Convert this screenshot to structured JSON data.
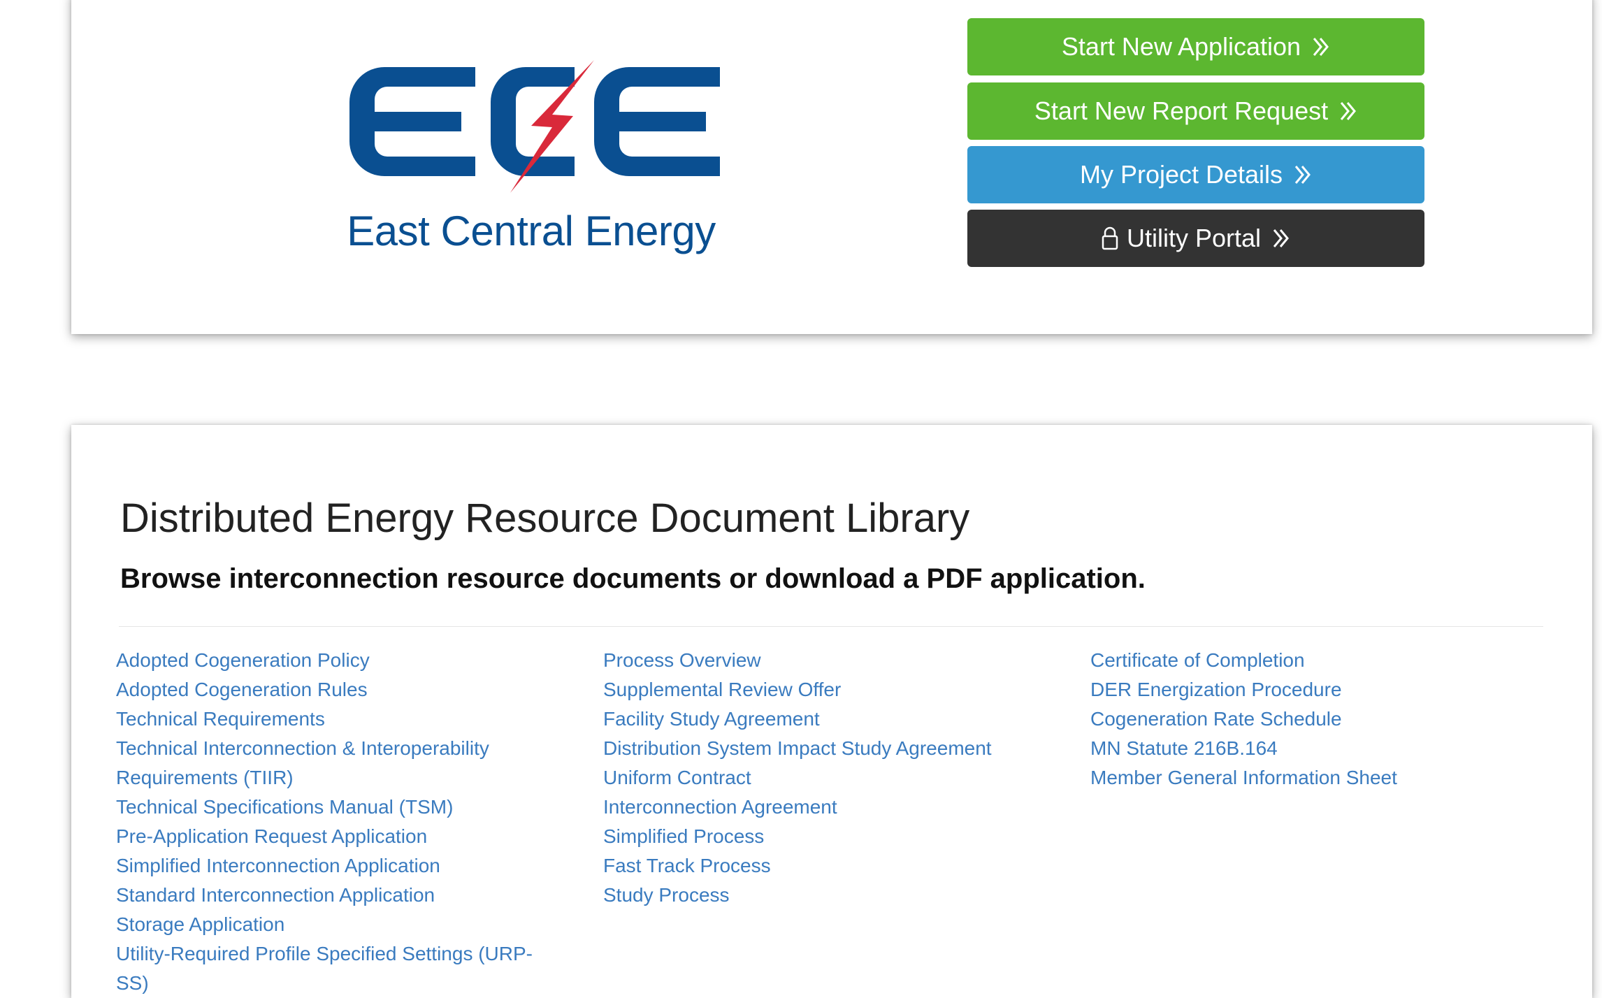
{
  "header": {
    "logo": {
      "lettering": "ECE",
      "name": "East Central Energy",
      "colors": {
        "blue": "#0a4f91",
        "red": "#d9293a"
      }
    },
    "buttons": [
      {
        "label": "Start New Application",
        "icon": "double-chevron-right-icon",
        "color": "#5cb730"
      },
      {
        "label": "Start New Report Request",
        "icon": "double-chevron-right-icon",
        "color": "#5cb730"
      },
      {
        "label": "My Project Details",
        "icon": "double-chevron-right-icon",
        "color": "#3598d0"
      },
      {
        "label": "Utility Portal",
        "icon": "double-chevron-right-icon",
        "leading_icon": "lock-icon",
        "color": "#333333"
      }
    ]
  },
  "library": {
    "title": "Distributed Energy Resource Document Library",
    "subtitle": "Browse interconnection resource documents or download a PDF application.",
    "link_color": "#3a7bbf",
    "columns": [
      [
        "Adopted Cogeneration Policy",
        "Adopted Cogeneration Rules",
        "Technical Requirements",
        "Technical Interconnection & Interoperability Requirements (TIIR)",
        "Technical Specifications Manual (TSM)",
        "Pre-Application Request Application",
        "Simplified Interconnection Application",
        "Standard Interconnection Application",
        "Storage Application",
        "Utility-Required Profile Specified Settings (URP-SS)"
      ],
      [
        "Process Overview",
        "Supplemental Review Offer",
        "Facility Study Agreement",
        "Distribution System Impact Study Agreement",
        "Uniform Contract",
        "Interconnection Agreement",
        "Simplified Process",
        "Fast Track Process",
        "Study Process"
      ],
      [
        "Certificate of Completion",
        "DER Energization Procedure",
        "Cogeneration Rate Schedule",
        "MN Statute 216B.164",
        "Member General Information Sheet"
      ]
    ]
  }
}
